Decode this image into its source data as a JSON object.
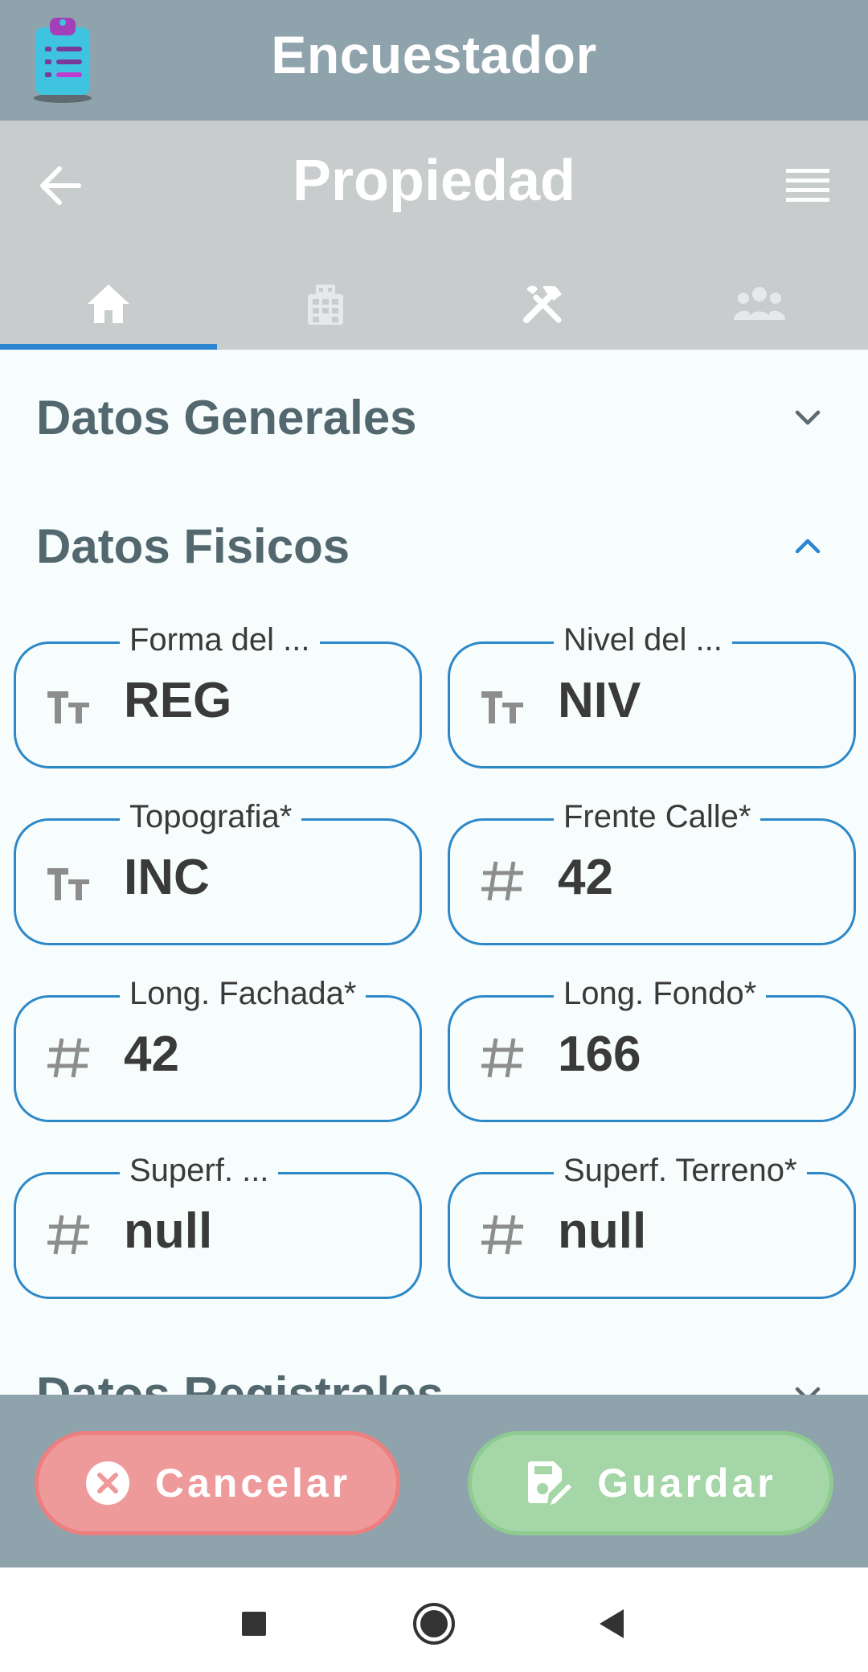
{
  "app": {
    "title": "Encuestador"
  },
  "page": {
    "title": "Propiedad"
  },
  "tabs": [
    {
      "name": "home",
      "icon": "home-icon",
      "active": true
    },
    {
      "name": "building",
      "icon": "building-icon",
      "active": false
    },
    {
      "name": "tools",
      "icon": "tools-icon",
      "active": false
    },
    {
      "name": "people",
      "icon": "people-icon",
      "active": false
    }
  ],
  "sections": {
    "generales": {
      "title": "Datos Generales",
      "expanded": false
    },
    "fisicos": {
      "title": "Datos Fisicos",
      "expanded": true
    },
    "registrales": {
      "title": "Datos Registrales",
      "expanded": false
    }
  },
  "fields": [
    {
      "label": "Forma del ...",
      "value": "REG",
      "icon": "text-type-icon"
    },
    {
      "label": "Nivel del ...",
      "value": "NIV",
      "icon": "text-type-icon"
    },
    {
      "label": "Topografia*",
      "value": "INC",
      "icon": "text-type-icon"
    },
    {
      "label": "Frente Calle*",
      "value": "42",
      "icon": "hash-icon"
    },
    {
      "label": "Long. Fachada*",
      "value": "42",
      "icon": "hash-icon"
    },
    {
      "label": "Long. Fondo*",
      "value": "166",
      "icon": "hash-icon"
    },
    {
      "label": "Superf. ...",
      "value": "null",
      "icon": "hash-icon"
    },
    {
      "label": "Superf. Terreno*",
      "value": "null",
      "icon": "hash-icon"
    }
  ],
  "actions": {
    "cancel_label": "Cancelar",
    "save_label": "Guardar"
  },
  "colors": {
    "appbar": "#8fa3ad",
    "pagebar": "#c8cccd",
    "accent": "#2b85d0",
    "cancel": "#ef9a9a",
    "save": "#a5d6a7",
    "section_text": "#53676e"
  }
}
